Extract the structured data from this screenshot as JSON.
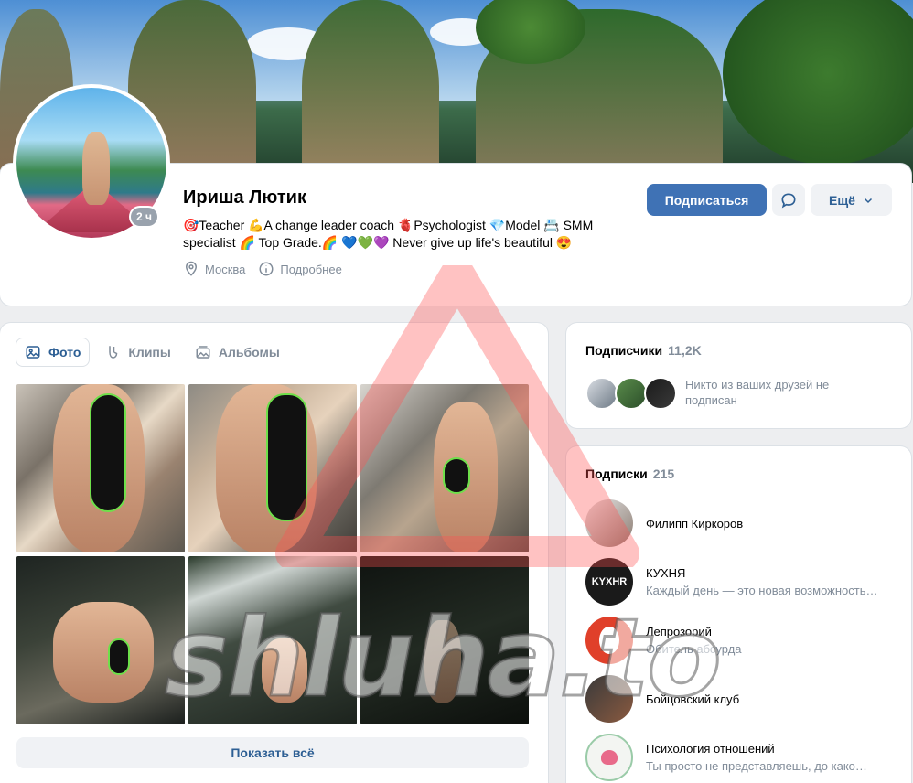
{
  "profile": {
    "name": "Ириша Лютик",
    "status": "🎯Teacher 💪A change leader coach 🫀Psychologist 💎Model 📇 SMM specialist 🌈 Top Grade.🌈 💙💚💜 Never give up life's beautiful 😍",
    "last_seen_badge": "2 ч",
    "city": "Москва",
    "details_link": "Подробнее",
    "subscribe_button": "Подписаться",
    "more_button": "Ещё"
  },
  "photos": {
    "tabs": [
      {
        "label": "Фото",
        "icon": "photo-icon",
        "active": true
      },
      {
        "label": "Клипы",
        "icon": "clips-icon",
        "active": false
      },
      {
        "label": "Альбомы",
        "icon": "albums-icon",
        "active": false
      }
    ],
    "show_all": "Показать всё"
  },
  "followers": {
    "title": "Подписчики",
    "count": "11,2K",
    "note": "Никто из ваших друзей не подписан"
  },
  "subscriptions": {
    "title": "Подписки",
    "count": "215",
    "items": [
      {
        "name": "Филипп Киркоров",
        "subtitle": ""
      },
      {
        "name": "КУХНЯ",
        "subtitle": "Каждый день — это новая возможность…"
      },
      {
        "name": "Лепрозорий",
        "subtitle": "Обитель абсурда"
      },
      {
        "name": "Бойцовский клуб",
        "subtitle": ""
      },
      {
        "name": "Психология отношений",
        "subtitle": "Ты просто не представляешь, до како…"
      }
    ]
  },
  "watermark": "shluha.to",
  "colors": {
    "accent": "#3f72b5",
    "link": "#2d5f94",
    "secondary_text": "#818c99",
    "background": "#edeef0"
  }
}
